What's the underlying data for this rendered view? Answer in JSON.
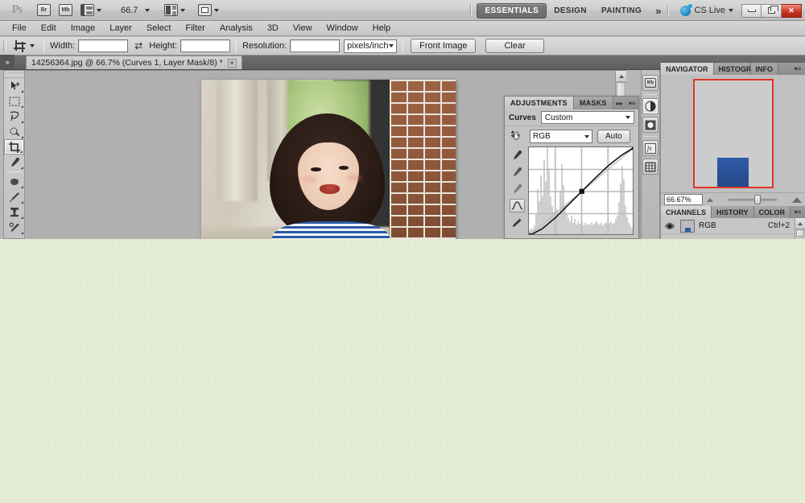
{
  "app": {
    "logo": "Ps",
    "zoom_level": "66.7",
    "workspaces": [
      {
        "label": "ESSENTIALS",
        "active": true
      },
      {
        "label": "DESIGN",
        "active": false
      },
      {
        "label": "PAINTING",
        "active": false
      }
    ],
    "workspace_more": "»",
    "cs_live": "CS Live",
    "window_buttons": {
      "minimize": "–",
      "restore": "❐",
      "close": "✕"
    }
  },
  "menubar": {
    "items": [
      "File",
      "Edit",
      "Image",
      "Layer",
      "Select",
      "Filter",
      "Analysis",
      "3D",
      "View",
      "Window",
      "Help"
    ]
  },
  "options_bar": {
    "tool": "crop-tool",
    "width_label": "Width:",
    "width_value": "",
    "swap_glyph": "⇄",
    "height_label": "Height:",
    "height_value": "",
    "resolution_label": "Resolution:",
    "resolution_value": "",
    "resolution_unit": "pixels/inch",
    "front_image_button": "Front Image",
    "clear_button": "Clear"
  },
  "document": {
    "tab_title": "14256364.jpg @ 66.7% (Curves 1, Layer Mask/8) *",
    "close_glyph": "✕",
    "strip_grip": "»"
  },
  "toolbox": {
    "tools": [
      {
        "name": "move-tool",
        "selected": false,
        "has_flyout": true
      },
      {
        "name": "rectangular-marquee-tool",
        "selected": false,
        "has_flyout": true
      },
      {
        "name": "lasso-tool",
        "selected": false,
        "has_flyout": true
      },
      {
        "name": "quick-selection-tool",
        "selected": false,
        "has_flyout": true
      },
      {
        "name": "crop-tool",
        "selected": true,
        "has_flyout": true
      },
      {
        "name": "eyedropper-tool",
        "selected": false,
        "has_flyout": true
      },
      {
        "name": "spot-healing-brush-tool",
        "selected": false,
        "has_flyout": true
      },
      {
        "name": "brush-tool",
        "selected": false,
        "has_flyout": true
      },
      {
        "name": "clone-stamp-tool",
        "selected": false,
        "has_flyout": true
      },
      {
        "name": "history-brush-tool",
        "selected": false,
        "has_flyout": true
      },
      {
        "name": "eraser-tool",
        "selected": false,
        "has_flyout": true
      }
    ]
  },
  "adjustments_panel": {
    "tabs": [
      {
        "label": "ADJUSTMENTS",
        "active": true
      },
      {
        "label": "MASKS",
        "active": false
      }
    ],
    "expand_glyph": "▸▸",
    "menu_glyph": "▾≡",
    "title": "Curves",
    "preset": "Custom",
    "channel": "RGB",
    "auto_button": "Auto",
    "on_image_tool": "on-image-adjustment-tool",
    "eyedroppers": [
      "set-black-point-eyedropper",
      "set-gray-point-eyedropper",
      "set-white-point-eyedropper"
    ],
    "curve_tool_active": "edit-points-curve-tool"
  },
  "curve_data": {
    "type": "line",
    "title": "Curves RGB",
    "xlim": [
      0,
      255
    ],
    "ylim": [
      0,
      255
    ],
    "grid": "4x4",
    "baseline": [
      [
        0,
        0
      ],
      [
        255,
        255
      ]
    ],
    "control_points": [
      [
        0,
        0
      ],
      [
        128,
        128
      ],
      [
        255,
        255
      ]
    ],
    "curve_points": [
      [
        0,
        0
      ],
      [
        32,
        20
      ],
      [
        64,
        52
      ],
      [
        96,
        90
      ],
      [
        128,
        128
      ],
      [
        160,
        166
      ],
      [
        192,
        202
      ],
      [
        224,
        232
      ],
      [
        255,
        255
      ]
    ],
    "histogram": [
      4,
      6,
      5,
      9,
      22,
      48,
      35,
      62,
      41,
      78,
      55,
      92,
      70,
      40,
      30,
      24,
      18,
      26,
      20,
      46,
      74,
      52,
      31,
      22,
      17,
      14,
      20,
      12,
      16,
      10,
      14,
      11,
      13,
      9,
      12,
      10,
      11,
      9,
      13,
      10,
      12,
      14,
      11,
      10,
      12,
      9,
      11,
      13,
      10,
      12,
      14,
      10,
      12,
      16,
      20,
      34,
      54,
      72,
      58,
      30,
      18,
      12,
      9,
      6
    ]
  },
  "icon_dock": {
    "icons": [
      {
        "name": "mini-bridge-icon",
        "label": "Mb",
        "selected": false
      },
      {
        "name": "adjustments-icon",
        "selected": true
      },
      {
        "name": "masks-icon",
        "selected": false
      },
      {
        "name": "styles-icon",
        "selected": false
      },
      {
        "name": "swatches-grid-icon",
        "selected": false
      }
    ]
  },
  "navigator_panel": {
    "tabs": [
      {
        "label": "NAVIGATOR",
        "active": true
      },
      {
        "label": "HISTOGRAM",
        "active": false
      },
      {
        "label": "INFO",
        "active": false
      }
    ],
    "menu_glyph": "▾≡",
    "zoom_value": "66.67%",
    "zoom_out_icon": "zoom-out-icon",
    "zoom_in_icon": "zoom-in-icon"
  },
  "channels_panel": {
    "tabs": [
      {
        "label": "CHANNELS",
        "active": true
      },
      {
        "label": "HISTORY",
        "active": false
      },
      {
        "label": "COLOR",
        "active": false
      }
    ],
    "menu_glyph": "▾≡",
    "rows": [
      {
        "name": "RGB",
        "shortcut": "Ctrl+2",
        "visible": true
      }
    ]
  },
  "colors": {
    "accent_red": "#e0352a",
    "close_button": "#c83422",
    "panel_bg": "#c4c4c4",
    "canvas_bg": "#b0b0b0",
    "backdrop_green": "#e4edd4"
  }
}
